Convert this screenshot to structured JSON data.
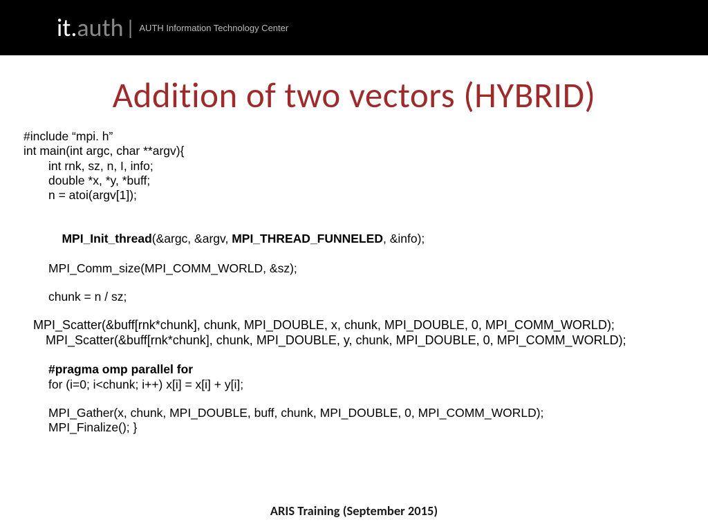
{
  "header": {
    "logo_it": "it.",
    "logo_auth": "auth",
    "pipe": "|",
    "org": "AUTH Information Technology Center"
  },
  "title": "Addition of two vectors (HYBRID)",
  "code": {
    "l1": "#include “mpi. h”",
    "l2": "int main(int argc, char **argv){",
    "l3": "int rnk, sz, n, I, info;",
    "l4": "double *x, *y, *buff;",
    "l5": "n = atoi(argv[1]);",
    "l6a": "MPI_Init_thread",
    "l6b": "(&argc, &argv, ",
    "l6c": "MPI_THREAD_FUNNELED",
    "l6d": ", &info);",
    "l7": "MPI_Comm_size(MPI_COMM_WORLD, &sz);",
    "l8": "chunk = n / sz;",
    "l9": "MPI_Scatter(&buff[rnk*chunk], chunk, MPI_DOUBLE, x, chunk, MPI_DOUBLE, 0, MPI_COMM_WORLD);",
    "l10": "MPI_Scatter(&buff[rnk*chunk], chunk, MPI_DOUBLE, y, chunk, MPI_DOUBLE, 0, MPI_COMM_WORLD);",
    "l11": "#pragma omp parallel for",
    "l12": "for (i=0; i<chunk; i++) x[i] = x[i] + y[i];",
    "l13": "MPI_Gather(x, chunk, MPI_DOUBLE, buff, chunk, MPI_DOUBLE, 0, MPI_COMM_WORLD);",
    "l14": "MPI_Finalize(); }"
  },
  "footer": "ARIS Training (September 2015)"
}
